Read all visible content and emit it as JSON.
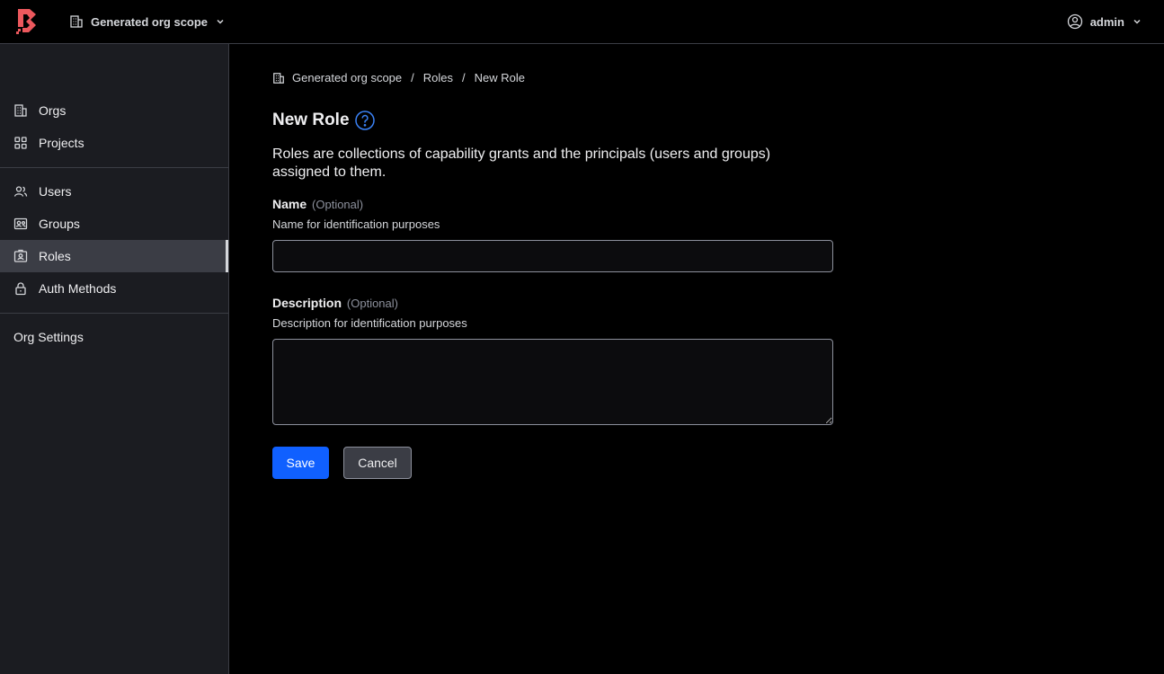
{
  "header": {
    "scope_label": "Generated org scope",
    "user_label": "admin"
  },
  "sidebar": {
    "groups": [
      [
        {
          "label": "Orgs",
          "icon": "building-icon"
        },
        {
          "label": "Projects",
          "icon": "grid-icon"
        }
      ],
      [
        {
          "label": "Users",
          "icon": "users-icon"
        },
        {
          "label": "Groups",
          "icon": "groups-icon"
        },
        {
          "label": "Roles",
          "icon": "roles-icon",
          "active": true
        },
        {
          "label": "Auth Methods",
          "icon": "lock-icon"
        }
      ],
      [
        {
          "label": "Org Settings"
        }
      ]
    ]
  },
  "breadcrumb": {
    "items": [
      "Generated org scope",
      "Roles",
      "New Role"
    ]
  },
  "page": {
    "title": "New Role",
    "description": "Roles are collections of capability grants and the principals (users and groups) assigned to them."
  },
  "form": {
    "name": {
      "label": "Name",
      "optional": "(Optional)",
      "help": "Name for identification purposes",
      "value": ""
    },
    "description": {
      "label": "Description",
      "optional": "(Optional)",
      "help": "Description for identification purposes",
      "value": ""
    },
    "save_label": "Save",
    "cancel_label": "Cancel"
  },
  "colors": {
    "brand": "#ec585d",
    "primary": "#1060ff",
    "help_icon": "#3b82f6"
  }
}
